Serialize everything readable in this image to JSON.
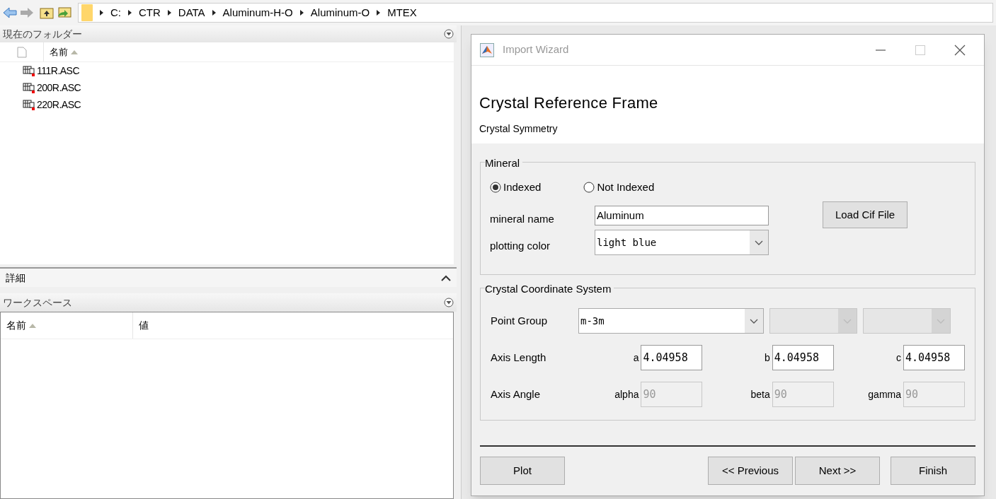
{
  "toolbar": {
    "path": [
      "C:",
      "CTR",
      "DATA",
      "Aluminum-H-O",
      "Aluminum-O",
      "MTEX"
    ]
  },
  "current_folder": {
    "title": "現在のフォルダー",
    "column": "名前",
    "files": [
      "111R.ASC",
      "200R.ASC",
      "220R.ASC"
    ]
  },
  "details": {
    "title": "詳細"
  },
  "workspace": {
    "title": "ワークスペース",
    "columns": [
      "名前",
      "値"
    ]
  },
  "dialog": {
    "title": "Import Wizard",
    "heading": "Crystal Reference Frame",
    "subheading": "Crystal Symmetry",
    "mineral": {
      "legend": "Mineral",
      "options": [
        {
          "label": "Indexed",
          "selected": true
        },
        {
          "label": "Not Indexed",
          "selected": false
        }
      ],
      "name_label": "mineral name",
      "name_value": "Aluminum",
      "color_label": "plotting color",
      "color_value": "light blue",
      "load_button": "Load Cif File"
    },
    "coordinate_system": {
      "legend": "Crystal Coordinate System",
      "point_group_label": "Point Group",
      "point_group": [
        {
          "value": "m-3m",
          "disabled": false
        },
        {
          "disabled": true
        },
        {
          "disabled": true
        }
      ],
      "rows": [
        {
          "label": "Axis Length",
          "fields": [
            {
              "name": "a",
              "value": "4.04958",
              "disabled": false
            },
            {
              "name": "b",
              "value": "4.04958",
              "disabled": false
            },
            {
              "name": "c",
              "value": "4.04958",
              "disabled": false
            }
          ]
        },
        {
          "label": "Axis Angle",
          "fields": [
            {
              "name": "alpha",
              "value": "90",
              "disabled": true
            },
            {
              "name": "beta",
              "value": "90",
              "disabled": true
            },
            {
              "name": "gamma",
              "value": "90",
              "disabled": true
            }
          ]
        }
      ]
    },
    "buttons": [
      "Plot",
      "<< Previous",
      "Next >>",
      "Finish"
    ]
  }
}
